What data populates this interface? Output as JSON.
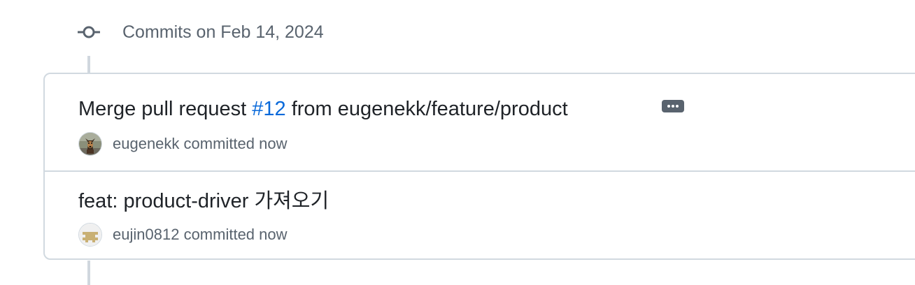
{
  "group": {
    "header": "Commits on Feb 14, 2024"
  },
  "commits": [
    {
      "title_prefix": "Merge pull request ",
      "pr_number": "#12",
      "title_suffix": " from eugenekk/feature/product",
      "author": "eugenekk",
      "committed_text": "committed now",
      "avatar_icon": "dog-photo-avatar"
    },
    {
      "title": "feat: product-driver 가져오기",
      "author": "eujin0812",
      "committed_text": "committed now",
      "avatar_icon": "identicon-avatar"
    }
  ],
  "colors": {
    "link": "#0969da",
    "muted": "#59636e",
    "border": "#d1d9e0"
  }
}
